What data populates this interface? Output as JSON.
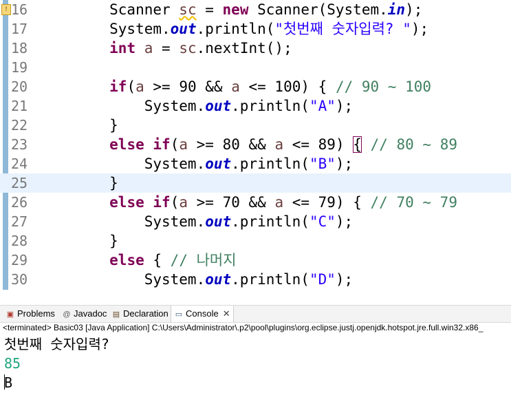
{
  "editor": {
    "lines": [
      {
        "num": "16",
        "tokens": [
          {
            "t": "        Scanner ",
            "c": ""
          },
          {
            "t": "sc",
            "c": "tok-local warn-underline"
          },
          {
            "t": " = ",
            "c": ""
          },
          {
            "t": "new",
            "c": "tok-kw"
          },
          {
            "t": " Scanner(System.",
            "c": ""
          },
          {
            "t": "in",
            "c": "tok-field"
          },
          {
            "t": ");",
            "c": ""
          }
        ]
      },
      {
        "num": "17",
        "tokens": [
          {
            "t": "        System.",
            "c": ""
          },
          {
            "t": "out",
            "c": "tok-field"
          },
          {
            "t": ".println(",
            "c": ""
          },
          {
            "t": "\"첫번째 숫자입력? \"",
            "c": "tok-str"
          },
          {
            "t": ");",
            "c": ""
          }
        ]
      },
      {
        "num": "18",
        "tokens": [
          {
            "t": "        ",
            "c": ""
          },
          {
            "t": "int",
            "c": "tok-kw"
          },
          {
            "t": " ",
            "c": ""
          },
          {
            "t": "a",
            "c": "tok-local"
          },
          {
            "t": " = ",
            "c": ""
          },
          {
            "t": "sc",
            "c": "tok-local"
          },
          {
            "t": ".nextInt();",
            "c": ""
          }
        ]
      },
      {
        "num": "19",
        "tokens": []
      },
      {
        "num": "20",
        "tokens": [
          {
            "t": "        ",
            "c": ""
          },
          {
            "t": "if",
            "c": "tok-kw"
          },
          {
            "t": "(",
            "c": ""
          },
          {
            "t": "a",
            "c": "tok-local"
          },
          {
            "t": " >= 90 && ",
            "c": ""
          },
          {
            "t": "a",
            "c": "tok-local"
          },
          {
            "t": " <= 100) { ",
            "c": ""
          },
          {
            "t": "// 90 ~ 100",
            "c": "tok-com"
          }
        ]
      },
      {
        "num": "21",
        "tokens": [
          {
            "t": "            System.",
            "c": ""
          },
          {
            "t": "out",
            "c": "tok-field"
          },
          {
            "t": ".println(",
            "c": ""
          },
          {
            "t": "\"A\"",
            "c": "tok-str"
          },
          {
            "t": ");",
            "c": ""
          }
        ]
      },
      {
        "num": "22",
        "tokens": [
          {
            "t": "        }",
            "c": ""
          }
        ]
      },
      {
        "num": "23",
        "tokens": [
          {
            "t": "        ",
            "c": ""
          },
          {
            "t": "else",
            "c": "tok-kw"
          },
          {
            "t": " ",
            "c": ""
          },
          {
            "t": "if",
            "c": "tok-kw"
          },
          {
            "t": "(",
            "c": ""
          },
          {
            "t": "a",
            "c": "tok-local"
          },
          {
            "t": " >= 80 && ",
            "c": ""
          },
          {
            "t": "a",
            "c": "tok-local"
          },
          {
            "t": " <= 89) ",
            "c": ""
          },
          {
            "t": "{",
            "c": "bracket-box"
          },
          {
            "t": " ",
            "c": ""
          },
          {
            "t": "// 80 ~ 89",
            "c": "tok-com"
          }
        ]
      },
      {
        "num": "24",
        "tokens": [
          {
            "t": "            System.",
            "c": ""
          },
          {
            "t": "out",
            "c": "tok-field"
          },
          {
            "t": ".println(",
            "c": ""
          },
          {
            "t": "\"B\"",
            "c": "tok-str"
          },
          {
            "t": ");",
            "c": ""
          }
        ]
      },
      {
        "num": "25",
        "current": true,
        "tokens": [
          {
            "t": "        }",
            "c": ""
          }
        ]
      },
      {
        "num": "26",
        "tokens": [
          {
            "t": "        ",
            "c": ""
          },
          {
            "t": "else",
            "c": "tok-kw"
          },
          {
            "t": " ",
            "c": ""
          },
          {
            "t": "if",
            "c": "tok-kw"
          },
          {
            "t": "(",
            "c": ""
          },
          {
            "t": "a",
            "c": "tok-local"
          },
          {
            "t": " >= 70 && ",
            "c": ""
          },
          {
            "t": "a",
            "c": "tok-local"
          },
          {
            "t": " <= 79) { ",
            "c": ""
          },
          {
            "t": "// 70 ~ 79",
            "c": "tok-com"
          }
        ]
      },
      {
        "num": "27",
        "tokens": [
          {
            "t": "            System.",
            "c": ""
          },
          {
            "t": "out",
            "c": "tok-field"
          },
          {
            "t": ".println(",
            "c": ""
          },
          {
            "t": "\"C\"",
            "c": "tok-str"
          },
          {
            "t": ");",
            "c": ""
          }
        ]
      },
      {
        "num": "28",
        "tokens": [
          {
            "t": "        }",
            "c": ""
          }
        ]
      },
      {
        "num": "29",
        "tokens": [
          {
            "t": "        ",
            "c": ""
          },
          {
            "t": "else",
            "c": "tok-kw"
          },
          {
            "t": " { ",
            "c": ""
          },
          {
            "t": "// 나머지",
            "c": "tok-com"
          }
        ]
      },
      {
        "num": "30",
        "tokens": [
          {
            "t": "            System.",
            "c": ""
          },
          {
            "t": "out",
            "c": "tok-field"
          },
          {
            "t": ".println(",
            "c": ""
          },
          {
            "t": "\"D\"",
            "c": "tok-str"
          },
          {
            "t": ");",
            "c": ""
          }
        ]
      }
    ],
    "warning_icon": "warning-marker-icon",
    "warning_icon_glyph": "!",
    "scroll_arrow": "◀",
    "changebar_color": "#8fb8d8"
  },
  "tabs": [
    {
      "label": "Problems",
      "icon": "problems-icon",
      "glyph": "▣",
      "color": "#b03a2e"
    },
    {
      "label": "Javadoc",
      "icon": "javadoc-icon",
      "glyph": "@",
      "color": "#5a5a5a"
    },
    {
      "label": "Declaration",
      "icon": "declaration-icon",
      "glyph": "▤",
      "color": "#6b4f2a"
    },
    {
      "label": "Console",
      "icon": "console-icon",
      "glyph": "▭",
      "color": "#2a4f7a",
      "active": true
    }
  ],
  "console_close": "✕",
  "status_line": "<terminated> Basic03 [Java Application] C:\\Users\\Administrator\\.p2\\pool\\plugins\\org.eclipse.justj.openjdk.hotspot.jre.full.win32.x86_",
  "console": {
    "lines": [
      {
        "text": "첫번째 숫자입력?",
        "kind": "out"
      },
      {
        "text": "85",
        "kind": "in"
      },
      {
        "text": "B",
        "kind": "out"
      }
    ]
  }
}
